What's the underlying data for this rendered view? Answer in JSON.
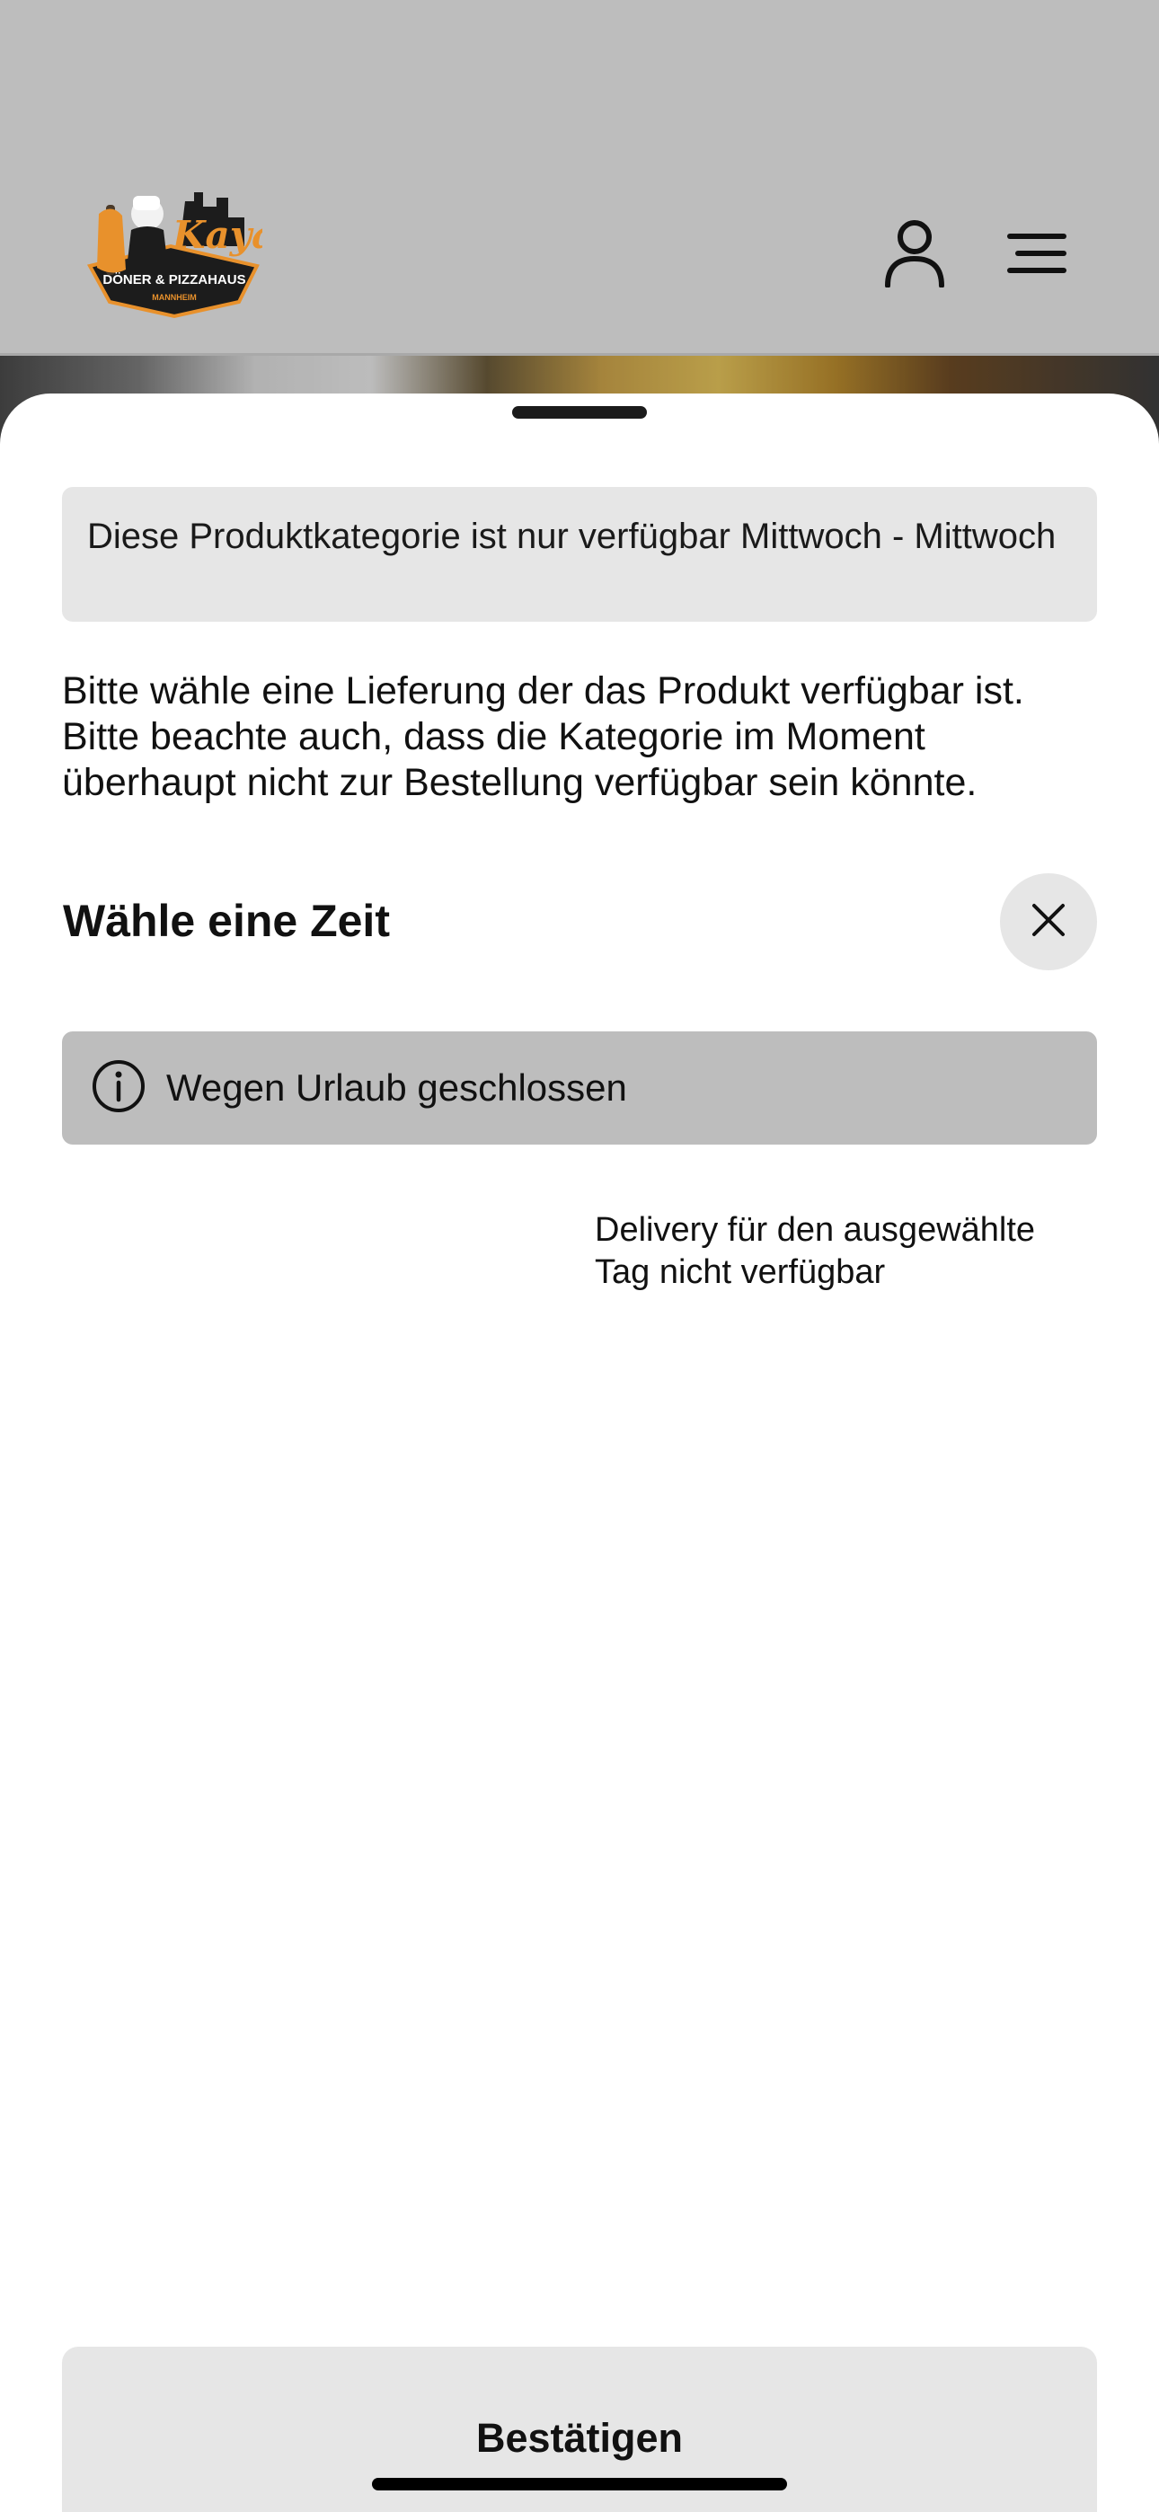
{
  "header": {
    "logo": {
      "name": "Kaya",
      "tagline": "DÖNER & PIZZAHAUS",
      "city": "MANNHEIM"
    },
    "icons": {
      "user": "user-icon",
      "menu": "menu-icon"
    }
  },
  "sheet": {
    "notice": "Diese Produktkategorie ist nur verfügbar Mittwoch - Mittwoch",
    "info_text": "Bitte wähle eine Lieferung der das Produkt verfügbar ist. Bitte beachte auch, dass die Kategorie im Moment überhaupt nicht zur Bestellung verfügbar sein könnte.",
    "section_title": "Wähle eine Zeit",
    "closed_banner": {
      "icon": "info-icon",
      "label": "Wegen Urlaub geschlossen"
    },
    "delivery_note": "Delivery für den ausgewählte Tag nicht verfügbar",
    "confirm_label": "Bestätigen"
  },
  "colors": {
    "overlay_gray": "#bdbdbd",
    "panel_gray": "#e6e6e6",
    "logo_orange": "#e8912c",
    "logo_dark": "#1c1c1c"
  }
}
